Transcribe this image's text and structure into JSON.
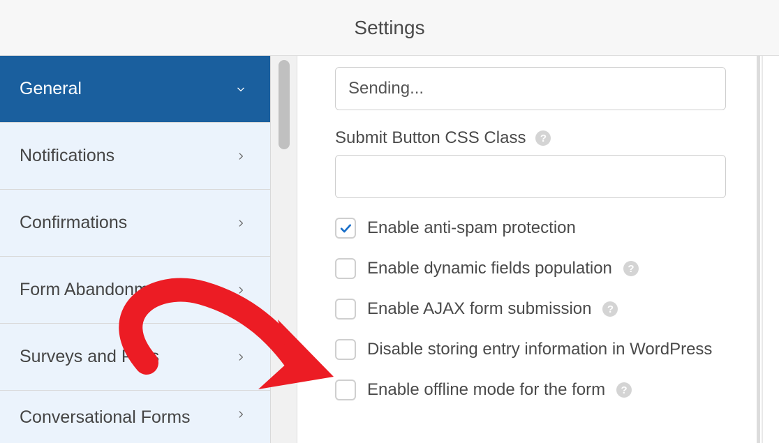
{
  "header": {
    "title": "Settings"
  },
  "sidebar": {
    "items": [
      {
        "label": "General",
        "open": true
      },
      {
        "label": "Notifications"
      },
      {
        "label": "Confirmations"
      },
      {
        "label": "Form Abandonment"
      },
      {
        "label": "Surveys and Polls"
      },
      {
        "label": "Conversational Forms"
      }
    ]
  },
  "panel": {
    "sending_input_value": "Sending...",
    "submit_css_label": "Submit Button CSS Class",
    "submit_css_value": "",
    "checks": [
      {
        "label": "Enable anti-spam protection",
        "checked": true,
        "help": false
      },
      {
        "label": "Enable dynamic fields population",
        "checked": false,
        "help": true
      },
      {
        "label": "Enable AJAX form submission",
        "checked": false,
        "help": true
      },
      {
        "label": "Disable storing entry information in WordPress",
        "checked": false,
        "help": false
      },
      {
        "label": "Enable offline mode for the form",
        "checked": false,
        "help": true
      }
    ]
  }
}
